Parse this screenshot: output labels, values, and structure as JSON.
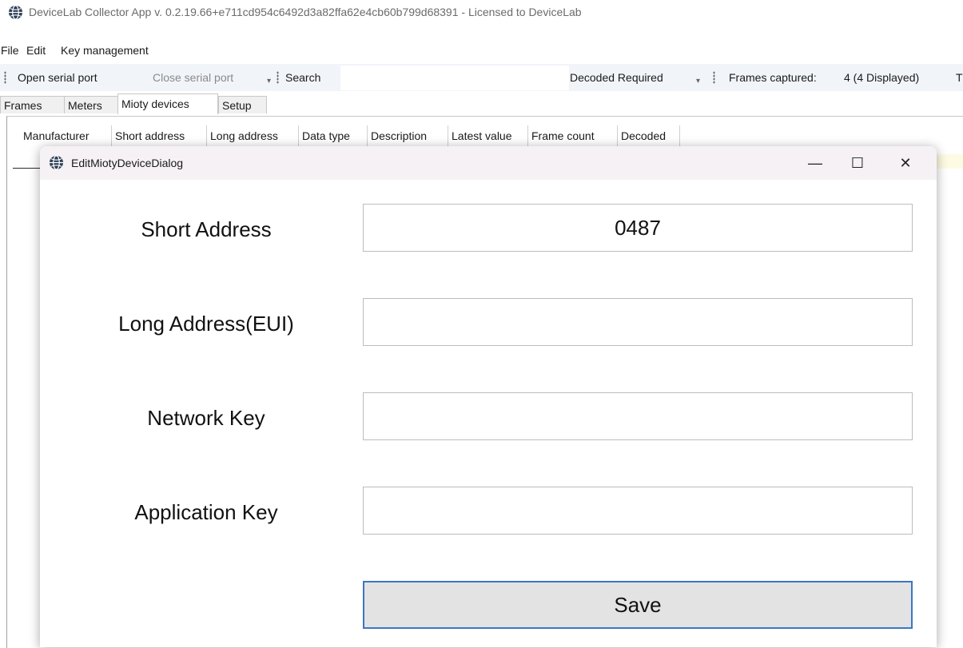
{
  "window": {
    "title": "DeviceLab Collector App v. 0.2.19.66+e711cd954c6492d3a82ffa62e4cb60b799d68391 - Licensed to DeviceLab",
    "icon": "globe-icon"
  },
  "menu": {
    "items": [
      "File",
      "Edit",
      "Key management"
    ]
  },
  "toolbar": {
    "open_serial": "Open serial port",
    "close_serial": "Close serial port",
    "search_label": "Search",
    "search_value": "",
    "decoded_required": "Decoded Required",
    "frames_captured_label": "Frames captured:",
    "frames_captured_value": "4 (4 Displayed)",
    "truncated_item": "T"
  },
  "tabs": [
    "Frames",
    "Meters",
    "Mioty devices",
    "Setup"
  ],
  "active_tab": "Mioty devices",
  "grid": {
    "columns": [
      "Manufacturer",
      "Short address",
      "Long address",
      "Data type",
      "Description",
      "Latest value",
      "Frame count",
      "Decoded"
    ]
  },
  "dialog": {
    "title": "EditMiotyDeviceDialog",
    "icon": "globe-icon",
    "fields": {
      "short_address": {
        "label": "Short Address",
        "value": "0487"
      },
      "long_address": {
        "label": "Long Address(EUI)",
        "value": ""
      },
      "network_key": {
        "label": "Network Key",
        "value": ""
      },
      "application_key": {
        "label": "Application Key",
        "value": ""
      }
    },
    "save_label": "Save",
    "minimize_glyph": "—",
    "maximize_glyph": "☐",
    "close_glyph": "✕"
  },
  "colors": {
    "toolbar_bg": "#f1f4f9",
    "save_border": "#3a76c5",
    "save_bg": "#e3e3e3",
    "dialog_title_bg": "#f5f1f4"
  }
}
